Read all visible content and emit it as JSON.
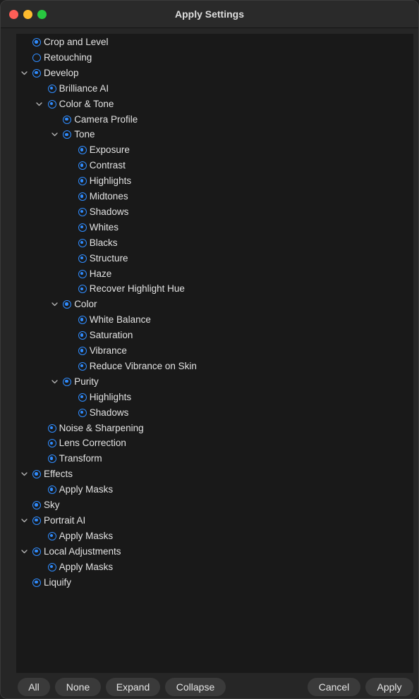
{
  "window": {
    "title": "Apply Settings"
  },
  "colors": {
    "accent": "#2f8cff",
    "panel_bg": "#191919",
    "window_bg": "#262626",
    "text": "#e3e3e3"
  },
  "tree": [
    {
      "label": "Crop and Level",
      "level": 0,
      "checked": true,
      "expandable": false
    },
    {
      "label": "Retouching",
      "level": 0,
      "checked": false,
      "expandable": false
    },
    {
      "label": "Develop",
      "level": 0,
      "checked": true,
      "expandable": true
    },
    {
      "label": "Brilliance AI",
      "level": 1,
      "checked": true,
      "expandable": false
    },
    {
      "label": "Color & Tone",
      "level": 1,
      "checked": true,
      "expandable": true
    },
    {
      "label": "Camera Profile",
      "level": 2,
      "checked": true,
      "expandable": false
    },
    {
      "label": "Tone",
      "level": 2,
      "checked": true,
      "expandable": true
    },
    {
      "label": "Exposure",
      "level": 3,
      "checked": true,
      "expandable": false
    },
    {
      "label": "Contrast",
      "level": 3,
      "checked": true,
      "expandable": false
    },
    {
      "label": "Highlights",
      "level": 3,
      "checked": true,
      "expandable": false
    },
    {
      "label": "Midtones",
      "level": 3,
      "checked": true,
      "expandable": false
    },
    {
      "label": "Shadows",
      "level": 3,
      "checked": true,
      "expandable": false
    },
    {
      "label": "Whites",
      "level": 3,
      "checked": true,
      "expandable": false
    },
    {
      "label": "Blacks",
      "level": 3,
      "checked": true,
      "expandable": false
    },
    {
      "label": "Structure",
      "level": 3,
      "checked": true,
      "expandable": false
    },
    {
      "label": "Haze",
      "level": 3,
      "checked": true,
      "expandable": false
    },
    {
      "label": "Recover Highlight Hue",
      "level": 3,
      "checked": true,
      "expandable": false
    },
    {
      "label": "Color",
      "level": 2,
      "checked": true,
      "expandable": true
    },
    {
      "label": "White Balance",
      "level": 3,
      "checked": true,
      "expandable": false
    },
    {
      "label": "Saturation",
      "level": 3,
      "checked": true,
      "expandable": false
    },
    {
      "label": "Vibrance",
      "level": 3,
      "checked": true,
      "expandable": false
    },
    {
      "label": "Reduce Vibrance on Skin",
      "level": 3,
      "checked": true,
      "expandable": false
    },
    {
      "label": "Purity",
      "level": 2,
      "checked": true,
      "expandable": true
    },
    {
      "label": "Highlights",
      "level": 3,
      "checked": true,
      "expandable": false
    },
    {
      "label": "Shadows",
      "level": 3,
      "checked": true,
      "expandable": false
    },
    {
      "label": "Noise & Sharpening",
      "level": 1,
      "checked": true,
      "expandable": false
    },
    {
      "label": "Lens Correction",
      "level": 1,
      "checked": true,
      "expandable": false
    },
    {
      "label": "Transform",
      "level": 1,
      "checked": true,
      "expandable": false
    },
    {
      "label": "Effects",
      "level": 0,
      "checked": true,
      "expandable": true
    },
    {
      "label": "Apply Masks",
      "level": 1,
      "checked": true,
      "expandable": false
    },
    {
      "label": "Sky",
      "level": 0,
      "checked": true,
      "expandable": false
    },
    {
      "label": "Portrait AI",
      "level": 0,
      "checked": true,
      "expandable": true
    },
    {
      "label": "Apply Masks",
      "level": 1,
      "checked": true,
      "expandable": false
    },
    {
      "label": "Local Adjustments",
      "level": 0,
      "checked": true,
      "expandable": true
    },
    {
      "label": "Apply Masks",
      "level": 1,
      "checked": true,
      "expandable": false
    },
    {
      "label": "Liquify",
      "level": 0,
      "checked": true,
      "expandable": false
    }
  ],
  "buttons": {
    "all": "All",
    "none": "None",
    "expand": "Expand",
    "collapse": "Collapse",
    "cancel": "Cancel",
    "apply": "Apply"
  }
}
